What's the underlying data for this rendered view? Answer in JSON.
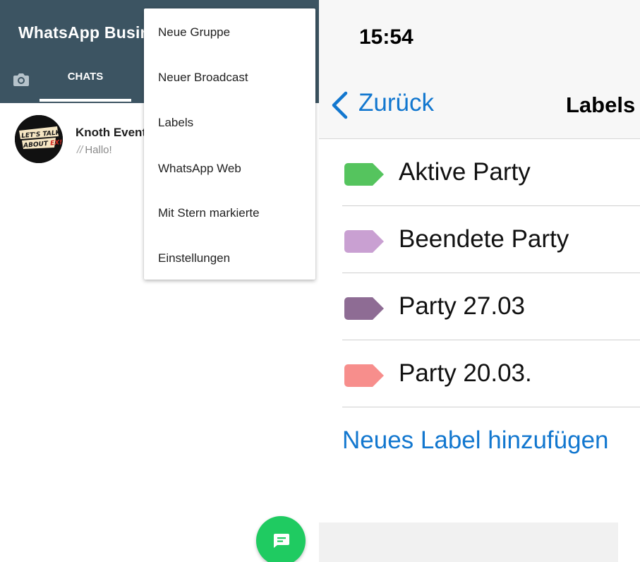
{
  "android": {
    "app_title": "WhatsApp Business",
    "tabs": {
      "chats": "CHATS"
    },
    "chat": {
      "name": "Knoth Events",
      "preview": "Hallo!",
      "avatar_text": "LET'S TALK ABOUT EX!"
    },
    "menu": [
      "Neue Gruppe",
      "Neuer Broadcast",
      "Labels",
      "WhatsApp Web",
      "Mit Stern markierte",
      "Einstellungen"
    ],
    "colors": {
      "appbar": "#3c5462",
      "fab": "#1fcb61"
    }
  },
  "ios": {
    "time": "15:54",
    "back_label": "Zurück",
    "title": "Labels",
    "labels": [
      {
        "name": "Aktive Party",
        "color": "#55c45e"
      },
      {
        "name": "Beendete Party",
        "color": "#c9a0d2"
      },
      {
        "name": "Party 27.03",
        "color": "#8e6c94"
      },
      {
        "name": "Party 20.03.",
        "color": "#f78e8c"
      }
    ],
    "add_label": "Neues Label hinzufügen",
    "colors": {
      "accent": "#1277cf"
    }
  }
}
